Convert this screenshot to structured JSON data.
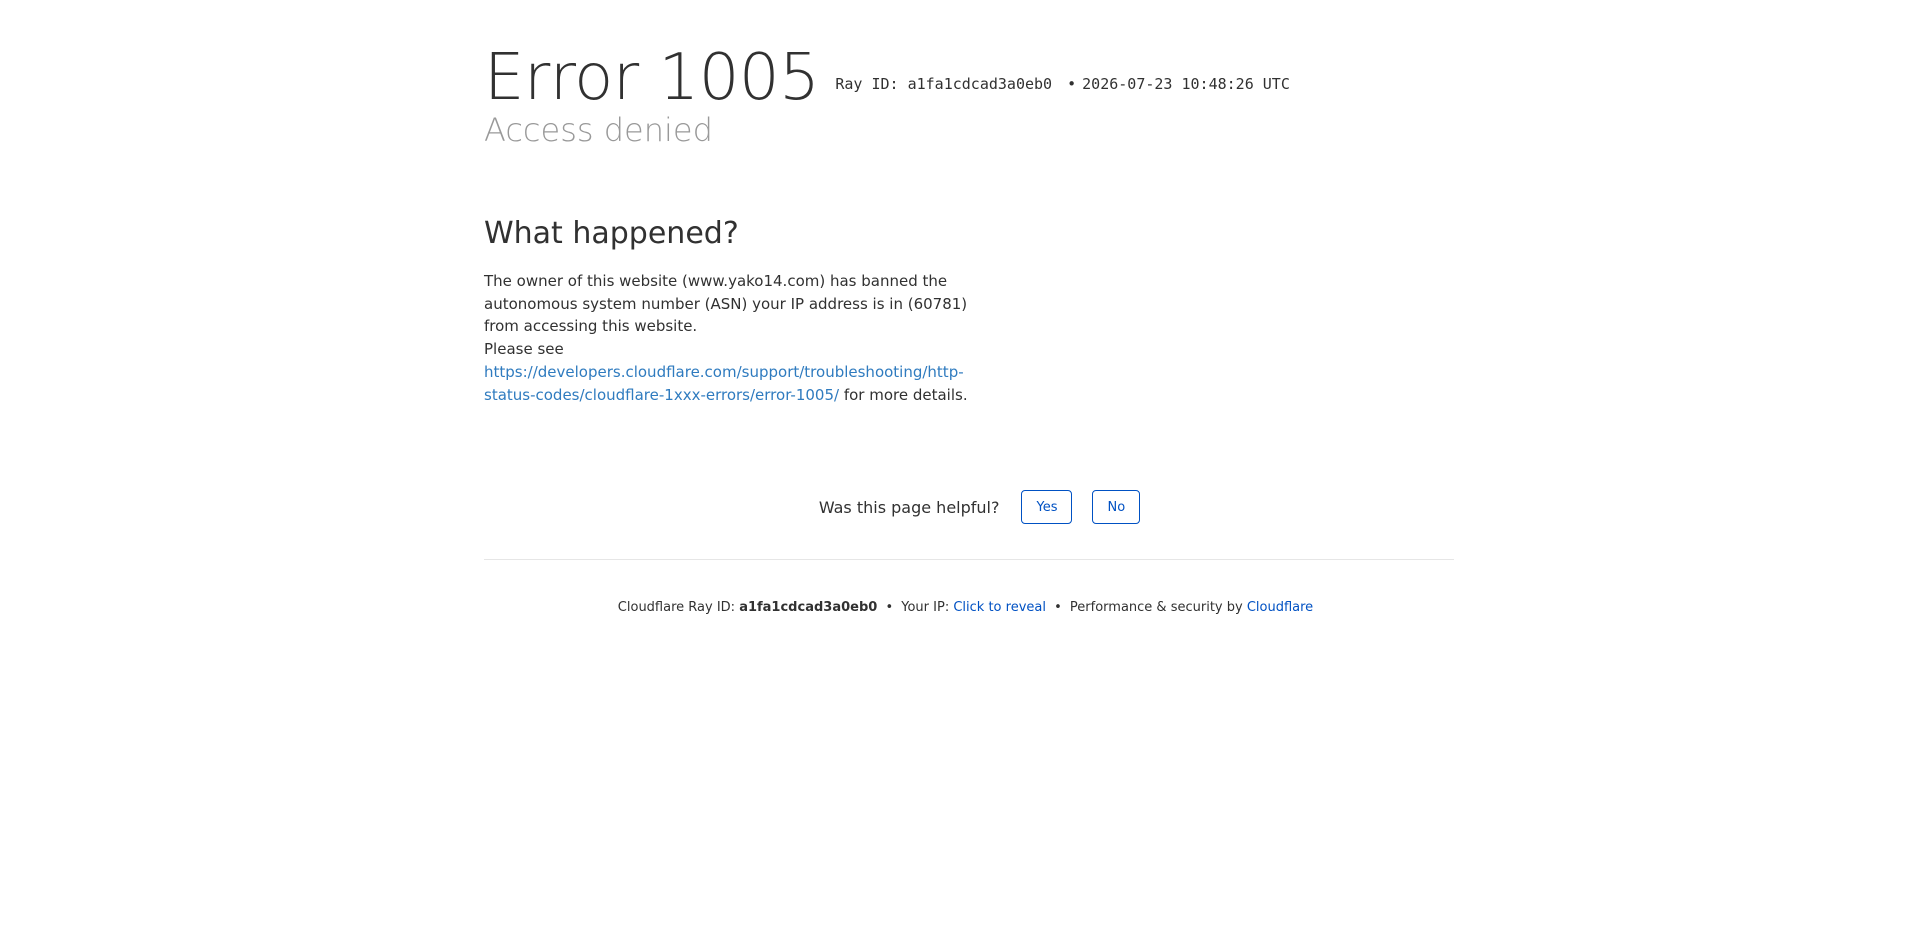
{
  "header": {
    "error_title": "Error 1005",
    "ray_id_label": "Ray ID:",
    "ray_id": "a1fa1cdcad3a0eb0",
    "bullet": "•",
    "timestamp": "2026-07-23 10:48:26 UTC",
    "subtitle": "Access denied"
  },
  "what_happened": {
    "heading": "What happened?",
    "body_1": "The owner of this website (www.yako14.com) has banned the autonomous system number (ASN) your IP address is in (60781) from accessing this website.",
    "body_2": "Please see",
    "link": "https://developers.cloudflare.com/support/troubleshooting/http-status-codes/cloudflare-1xxx-errors/error-1005/",
    "body_3": "for more details."
  },
  "feedback": {
    "question": "Was this page helpful?",
    "yes_label": "Yes",
    "no_label": "No"
  },
  "footer": {
    "ray_label": "Cloudflare Ray ID:",
    "ray_id": "a1fa1cdcad3a0eb0",
    "bullet": "•",
    "ip_label": "Your IP:",
    "ip_link": "Click to reveal",
    "perf_label": "Performance & security by",
    "cf_link": "Cloudflare"
  }
}
